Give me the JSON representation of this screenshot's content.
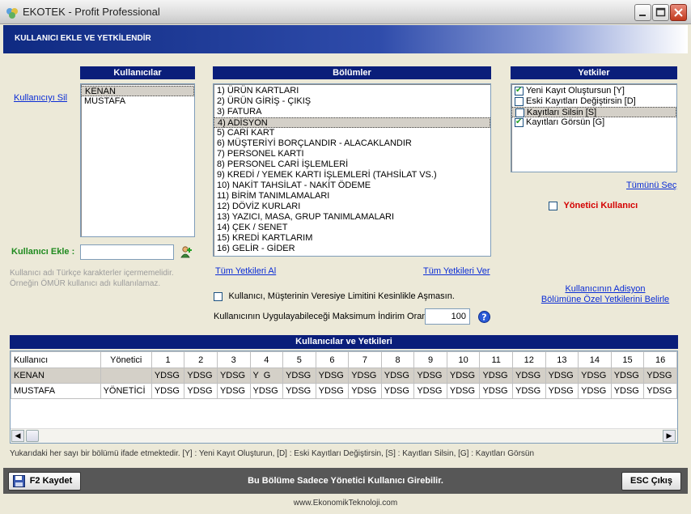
{
  "window": {
    "title": "EKOTEK - Profit Professional"
  },
  "header": {
    "title": "KULLANICI EKLE VE YETKİLENDİR"
  },
  "users": {
    "heading": "Kullanıcılar",
    "delete_link": "Kullanıcıyı Sil",
    "items": [
      "KENAN",
      "MUSTAFA"
    ],
    "selected": "KENAN",
    "add_label": "Kullanıcı Ekle :",
    "add_value": "",
    "hint_line1": "Kullanıcı adı Türkçe karakterler içermemelidir.",
    "hint_line2": "Örneğin ÖMÜR kullanıcı adı kullanılamaz."
  },
  "sections": {
    "heading": "Bölümler",
    "items": [
      "1)  ÜRÜN KARTLARI",
      "2)  ÜRÜN GİRİŞ - ÇIKIŞ",
      "3)  FATURA",
      "4)  ADİSYON",
      "5)  CARİ KART",
      "6)  MÜŞTERİYİ BORÇLANDIR - ALACAKLANDIR",
      "7)  PERSONEL KARTI",
      "8)  PERSONEL CARİ İŞLEMLERİ",
      "9)  KREDİ / YEMEK KARTI İŞLEMLERİ (TAHSİLAT VS.)",
      "10) NAKİT TAHSİLAT - NAKİT ÖDEME",
      "11) BİRİM TANIMLAMALARI",
      "12) DÖVİZ KURLARI",
      "13) YAZICI, MASA, GRUP TANIMLAMALARI",
      "14) ÇEK / SENET",
      "15) KREDİ KARTLARIM",
      "16) GELİR - GİDER"
    ],
    "selected_index": 3,
    "take_all_link": "Tüm Yetkileri Al",
    "give_all_link": "Tüm Yetkileri Ver",
    "credit_limit_label": "Kullanıcı, Müşterinin Veresiye Limitini Kesinlikle Aşmasın.",
    "credit_limit_checked": false,
    "discount_label": "Kullanıcının Uygulayabileceği Maksimum İndirim Oranı",
    "discount_value": "100"
  },
  "permissions": {
    "heading": "Yetkiler",
    "items": [
      {
        "label": "Yeni Kayıt Oluştursun [Y]",
        "checked": true,
        "selected": false
      },
      {
        "label": "Eski Kayıtları Değiştirsin [D]",
        "checked": false,
        "selected": false
      },
      {
        "label": "Kayıtları Silsin [S]",
        "checked": false,
        "selected": true
      },
      {
        "label": "Kayıtları Görsün [G]",
        "checked": true,
        "selected": false
      }
    ],
    "select_all_link": "Tümünü Seç",
    "admin_label": "Yönetici Kullanıcı",
    "admin_checked": false,
    "adisyon_link_line1": "Kullanıcının Adisyon",
    "adisyon_link_line2": "Bölümüne Özel Yetkilerini Belirle"
  },
  "grid": {
    "heading": "Kullanıcılar ve Yetkileri",
    "columns": [
      "Kullanıcı",
      "Yönetici",
      "1",
      "2",
      "3",
      "4",
      "5",
      "6",
      "7",
      "8",
      "9",
      "10",
      "11",
      "12",
      "13",
      "14",
      "15",
      "16"
    ],
    "rows": [
      [
        "KENAN",
        "",
        "YDSG",
        "YDSG",
        "YDSG",
        "Y  G",
        "YDSG",
        "YDSG",
        "YDSG",
        "YDSG",
        "YDSG",
        "YDSG",
        "YDSG",
        "YDSG",
        "YDSG",
        "YDSG",
        "YDSG",
        "YDSG"
      ],
      [
        "MUSTAFA",
        "YÖNETİCİ",
        "YDSG",
        "YDSG",
        "YDSG",
        "YDSG",
        "YDSG",
        "YDSG",
        "YDSG",
        "YDSG",
        "YDSG",
        "YDSG",
        "YDSG",
        "YDSG",
        "YDSG",
        "YDSG",
        "YDSG",
        "YDSG"
      ]
    ],
    "selected_row": 0
  },
  "footer": {
    "note": "Yukarıdaki her sayı bir bölümü ifade etmektedir.  [Y] : Yeni Kayıt Oluşturun, [D] : Eski Kayıtları Değiştirsin, [S] : Kayıtları Silsin, [G] : Kayıtları Görsün",
    "save_button": "F2 Kaydet",
    "message": "Bu Bölüme Sadece Yönetici Kullanıcı Girebilir.",
    "exit_button": "ESC Çıkış",
    "website": "www.EkonomikTeknoloji.com"
  }
}
